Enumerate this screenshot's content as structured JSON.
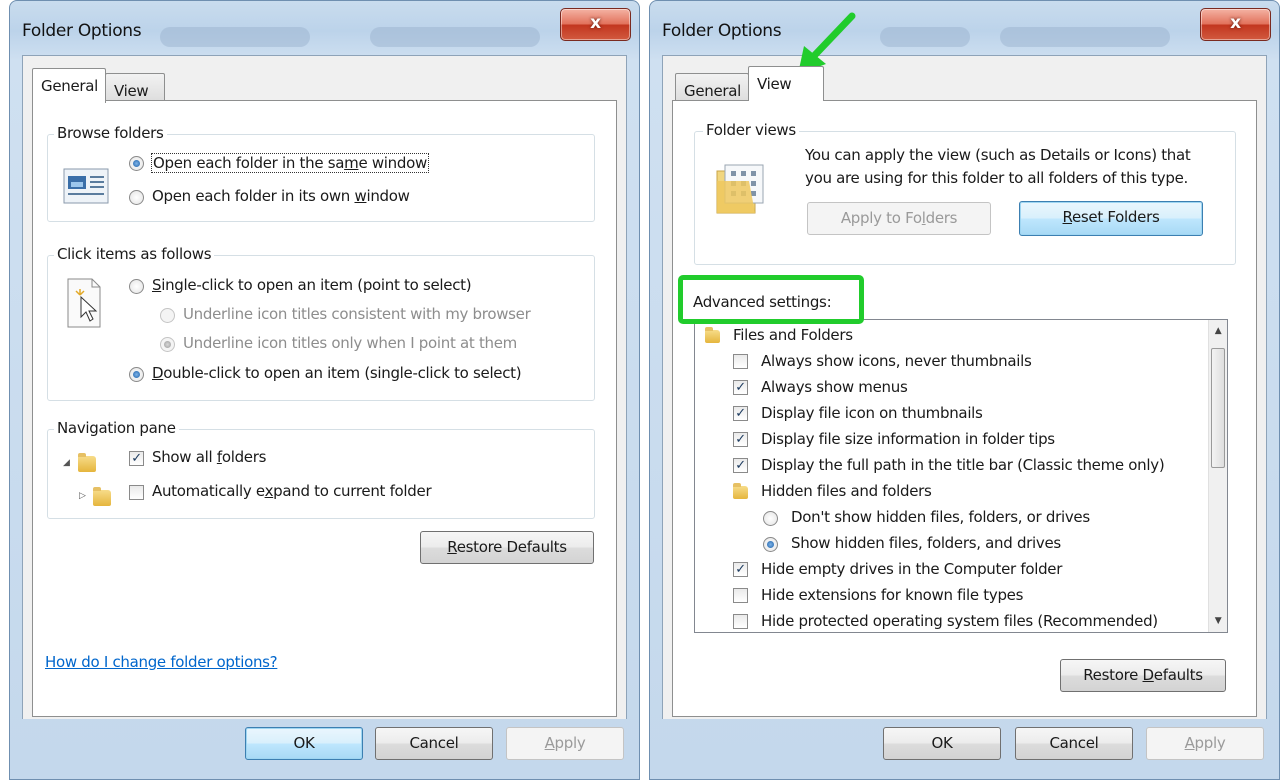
{
  "left": {
    "title": "Folder Options",
    "close_glyph": "x",
    "tabs": [
      {
        "label": "General"
      },
      {
        "label": "View"
      }
    ],
    "browse": {
      "label": "Browse folders",
      "options": [
        {
          "pre": "Open each folder in the sa",
          "u": "m",
          "post": "e window",
          "checked": true
        },
        {
          "pre": "Open each folder in its own ",
          "u": "w",
          "post": "indow",
          "checked": false
        }
      ]
    },
    "click": {
      "label": "Click items as follows",
      "single": {
        "pre": "",
        "u": "S",
        "post": "ingle-click to open an item (point to select)"
      },
      "underline_browser": "Underline icon titles consistent with my browser",
      "underline_point": "Underline icon titles only when I point at them",
      "double": {
        "pre": "",
        "u": "D",
        "post": "ouble-click to open an item (single-click to select)"
      }
    },
    "nav": {
      "label": "Navigation pane",
      "show_all": {
        "pre": "Show all ",
        "u": "f",
        "post": "olders",
        "checked": true
      },
      "auto_expand": {
        "pre": "Automatically e",
        "u": "x",
        "post": "pand to current folder",
        "checked": false
      }
    },
    "restore": {
      "pre": "",
      "u": "R",
      "post": "estore Defaults"
    },
    "help_link": "How do I change folder options?",
    "ok": "OK",
    "cancel": "Cancel",
    "apply": {
      "pre": "",
      "u": "A",
      "post": "pply"
    }
  },
  "right": {
    "title": "Folder Options",
    "close_glyph": "x",
    "tabs": [
      {
        "label": "General"
      },
      {
        "label": "View"
      }
    ],
    "folder_views": {
      "label": "Folder views",
      "desc1": "You can apply the view (such as Details or Icons) that",
      "desc2": "you are using for this folder to all folders of this type.",
      "apply_to": {
        "pre": "Apply to Fo",
        "u": "l",
        "post": "ders"
      },
      "reset": {
        "pre": "",
        "u": "R",
        "post": "eset Folders"
      }
    },
    "advanced_label": "Advanced settings:",
    "advanced_items": [
      {
        "kind": "folder",
        "text": "Files and Folders",
        "indent": 0
      },
      {
        "kind": "check",
        "text": "Always show icons, never thumbnails",
        "checked": false,
        "indent": 1
      },
      {
        "kind": "check",
        "text": "Always show menus",
        "checked": true,
        "indent": 1
      },
      {
        "kind": "check",
        "text": "Display file icon on thumbnails",
        "checked": true,
        "indent": 1
      },
      {
        "kind": "check",
        "text": "Display file size information in folder tips",
        "checked": true,
        "indent": 1
      },
      {
        "kind": "check",
        "text": "Display the full path in the title bar (Classic theme only)",
        "checked": true,
        "indent": 1
      },
      {
        "kind": "folder",
        "text": "Hidden files and folders",
        "indent": 1
      },
      {
        "kind": "radio",
        "text": "Don't show hidden files, folders, or drives",
        "checked": false,
        "indent": 2
      },
      {
        "kind": "radio",
        "text": "Show hidden files, folders, and drives",
        "checked": true,
        "indent": 2
      },
      {
        "kind": "check",
        "text": "Hide empty drives in the Computer folder",
        "checked": true,
        "indent": 1
      },
      {
        "kind": "check",
        "text": "Hide extensions for known file types",
        "checked": false,
        "indent": 1
      },
      {
        "kind": "check",
        "text": "Hide protected operating system files (Recommended)",
        "checked": false,
        "indent": 1
      }
    ],
    "restore": {
      "pre": "Restore ",
      "u": "D",
      "post": "efaults"
    },
    "ok": "OK",
    "cancel": "Cancel",
    "apply": {
      "pre": "",
      "u": "A",
      "post": "pply"
    }
  },
  "colors": {
    "annotation": "#21cc2c",
    "link": "#0066cc"
  },
  "check_glyph": "✓"
}
